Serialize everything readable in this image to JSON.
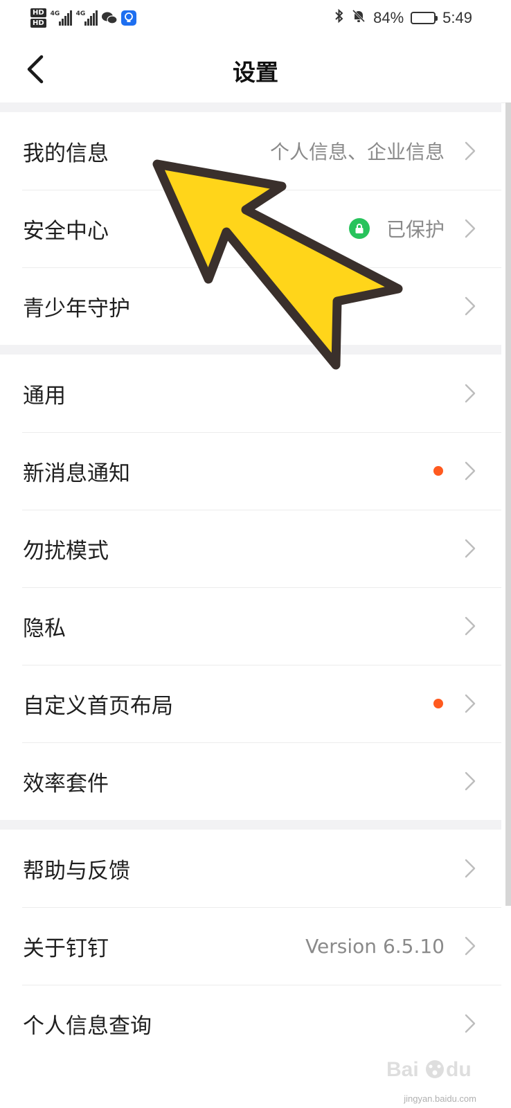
{
  "status_bar": {
    "hd1": "HD",
    "hd2": "HD",
    "net1": "4G",
    "net2": "4G",
    "battery_pct": "84%",
    "battery_level": 0.84,
    "time": "5:49",
    "icons": [
      "hd-icon",
      "signal-icon",
      "wechat-icon",
      "bulb-icon",
      "bluetooth-icon",
      "bell-off-icon",
      "battery-icon"
    ]
  },
  "header": {
    "title": "设置",
    "back_icon": "back-arrow-icon"
  },
  "sections": [
    {
      "items": [
        {
          "label": "我的信息",
          "value": "个人信息、企业信息"
        },
        {
          "label": "安全中心",
          "value": "已保护",
          "icon": "lock-icon"
        },
        {
          "label": "青少年守护",
          "value": ""
        }
      ]
    },
    {
      "items": [
        {
          "label": "通用",
          "value": ""
        },
        {
          "label": "新消息通知",
          "value": "",
          "badge": "red-dot"
        },
        {
          "label": "勿扰模式",
          "value": ""
        },
        {
          "label": "隐私",
          "value": ""
        },
        {
          "label": "自定义首页布局",
          "value": "",
          "badge": "red-dot"
        },
        {
          "label": "效率套件",
          "value": ""
        }
      ]
    },
    {
      "items": [
        {
          "label": "帮助与反馈",
          "value": ""
        },
        {
          "label": "关于钉钉",
          "value": "Version 6.5.10"
        },
        {
          "label": "个人信息查询",
          "value": ""
        }
      ]
    }
  ],
  "colors": {
    "accent_green": "#28c35c",
    "badge_red": "#ff5a1f",
    "arrow_yellow": "#ffd51a",
    "divider": "#f2f2f4"
  },
  "overlay": {
    "icon": "yellow-arrow-annotation-icon"
  },
  "watermark": {
    "icon": "baidu-watermark-icon",
    "text": "jingyan.baidu.com"
  }
}
